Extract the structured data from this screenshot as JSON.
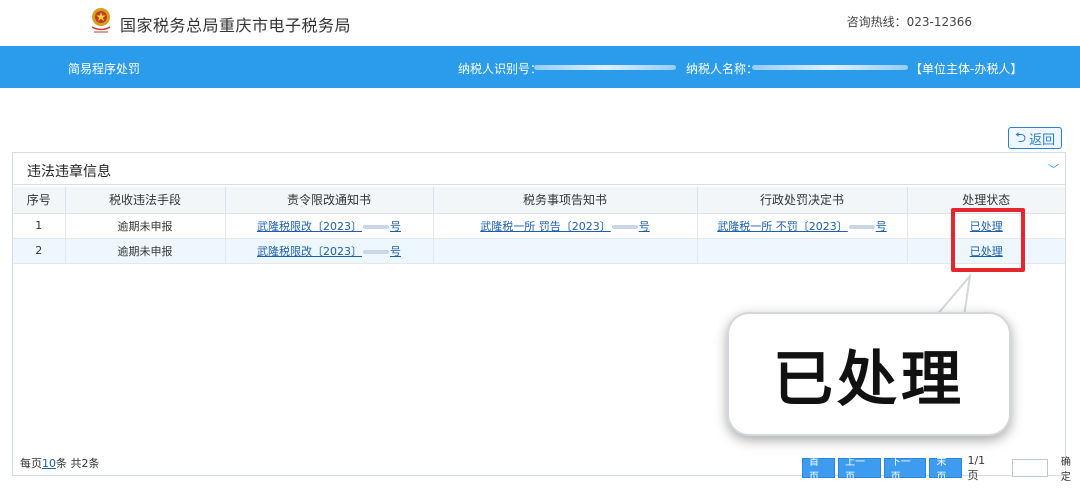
{
  "header": {
    "site_title": "国家税务总局重庆市电子税务局",
    "hotline": "咨询热线：023-12366"
  },
  "nav": {
    "page_title": "简易程序处罚",
    "taxpayer_id_label": "纳税人识别号：",
    "taxpayer_name_label": "纳税人名称：",
    "role": "【单位主体-办税人】"
  },
  "back_button": {
    "label": "返回",
    "icon": "return-arrow-icon"
  },
  "panel": {
    "title": "违法违章信息",
    "columns": [
      "序号",
      "税收违法手段",
      "责令限改通知书",
      "税务事项告知书",
      "行政处罚决定书",
      "处理状态"
    ],
    "rows": [
      {
        "index": "1",
        "means": "逾期未申报",
        "order_notice_prefix": "武隆税限改〔2023〕",
        "order_notice_suffix": "号",
        "matter_notice_prefix": "武隆税一所 罚告〔2023〕",
        "matter_notice_suffix": "号",
        "decision_prefix": "武隆税一所 不罚〔2023〕",
        "decision_suffix": "号",
        "status": "已处理"
      },
      {
        "index": "2",
        "means": "逾期未申报",
        "order_notice_prefix": "武隆税限改〔2023〕",
        "order_notice_suffix": "号",
        "matter_notice_prefix": "",
        "matter_notice_suffix": "",
        "decision_prefix": "",
        "decision_suffix": "",
        "status": "已处理"
      }
    ]
  },
  "footer": {
    "per_page_prefix": "每页",
    "per_page_value": "10",
    "per_page_suffix": "条 共2条",
    "buttons": [
      "首页",
      "上一页",
      "下一页",
      "末页"
    ],
    "page_info": "1/1页",
    "go_label": "确定"
  },
  "callout": {
    "text": "已处理"
  },
  "colors": {
    "nav_bg": "#2b9bec",
    "highlight": "#e5262f",
    "link": "#1b5fb0"
  }
}
